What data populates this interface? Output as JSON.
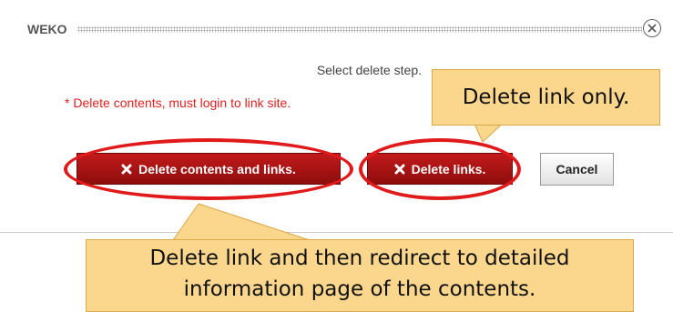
{
  "dialog": {
    "title": "WEKO",
    "instruction": "Select delete step.",
    "warning": "* Delete contents, must login to link site.",
    "buttons": {
      "delete_contents_and_links": "Delete contents and links.",
      "delete_links": "Delete links.",
      "cancel": "Cancel"
    }
  },
  "callouts": {
    "delete_link_only": "Delete link only.",
    "delete_link_redirect_line1": "Delete link and then redirect to detailed",
    "delete_link_redirect_line2": "information page of the contents."
  },
  "colors": {
    "danger_button": "#a81313",
    "highlight_ring": "#e01a1a",
    "callout_fill": "#fbd68d",
    "warning_text": "#e02020"
  },
  "icons": [
    "close-icon",
    "x-icon"
  ]
}
